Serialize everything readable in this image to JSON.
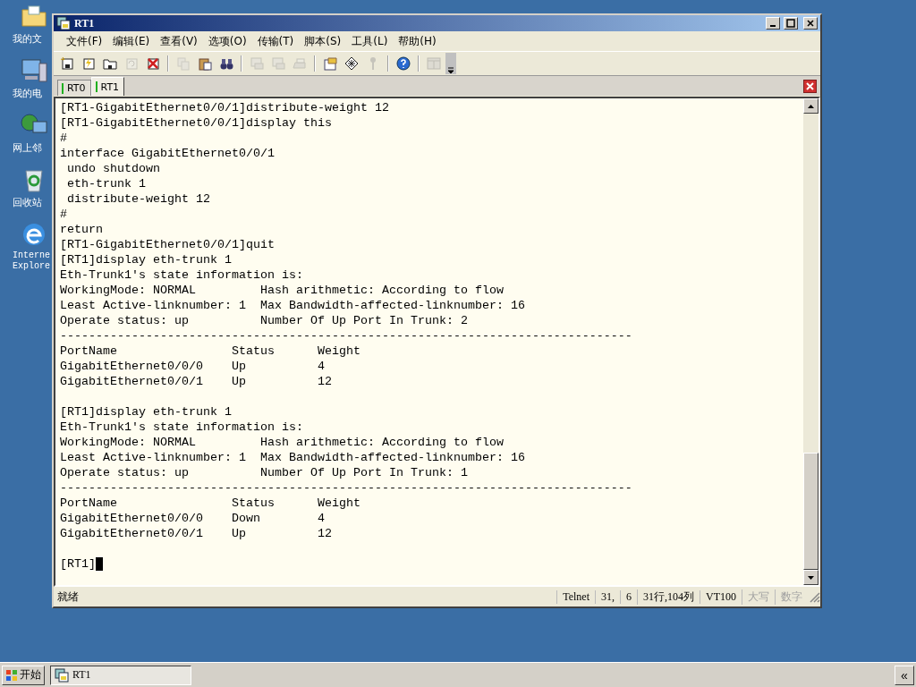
{
  "desktop_icons": [
    {
      "kind": "documents",
      "label": "我的文"
    },
    {
      "kind": "computer",
      "label": "我的电"
    },
    {
      "kind": "network",
      "label": "网上邻"
    },
    {
      "kind": "recycle",
      "label": "回收站"
    },
    {
      "kind": "browser",
      "label": "Interne\nExplore"
    }
  ],
  "window": {
    "title": "RT1"
  },
  "menu": [
    "文件(F)",
    "编辑(E)",
    "查看(V)",
    "选项(O)",
    "传输(T)",
    "脚本(S)",
    "工具(L)",
    "帮助(H)"
  ],
  "toolbar": [
    {
      "kind": "new-session",
      "disabled": false
    },
    {
      "kind": "quick-connect",
      "disabled": false
    },
    {
      "kind": "open-folder",
      "disabled": false
    },
    {
      "kind": "reconnect",
      "disabled": true
    },
    {
      "kind": "disconnect",
      "disabled": false
    },
    {
      "kind": "separator"
    },
    {
      "kind": "copy",
      "disabled": true
    },
    {
      "kind": "paste",
      "disabled": false
    },
    {
      "kind": "find",
      "disabled": false
    },
    {
      "kind": "separator"
    },
    {
      "kind": "print",
      "disabled": true
    },
    {
      "kind": "print",
      "disabled": true
    },
    {
      "kind": "printer",
      "disabled": true
    },
    {
      "kind": "separator"
    },
    {
      "kind": "options",
      "disabled": false
    },
    {
      "kind": "keymap",
      "disabled": false
    },
    {
      "kind": "key",
      "disabled": true
    },
    {
      "kind": "separator"
    },
    {
      "kind": "help",
      "disabled": false
    },
    {
      "kind": "separator"
    },
    {
      "kind": "tile",
      "disabled": true
    },
    {
      "kind": "more"
    }
  ],
  "tabs": [
    {
      "label": "RT0",
      "selected": false
    },
    {
      "label": "RT1",
      "selected": true
    }
  ],
  "terminal": {
    "lines": [
      {
        "kind": "text",
        "text": "[RT1-GigabitEthernet0/0/1]distribute-weight 12"
      },
      {
        "kind": "text",
        "text": "[RT1-GigabitEthernet0/0/1]display this"
      },
      {
        "kind": "text",
        "text": "#"
      },
      {
        "kind": "text",
        "text": "interface GigabitEthernet0/0/1"
      },
      {
        "kind": "text",
        "text": " undo shutdown"
      },
      {
        "kind": "text",
        "text": " eth-trunk 1"
      },
      {
        "kind": "text",
        "text": " distribute-weight 12"
      },
      {
        "kind": "text",
        "text": "#"
      },
      {
        "kind": "text",
        "text": "return"
      },
      {
        "kind": "text",
        "text": "[RT1-GigabitEthernet0/0/1]quit"
      },
      {
        "kind": "text",
        "text": "[RT1]display eth-trunk 1"
      },
      {
        "kind": "text",
        "text": "Eth-Trunk1's state information is:"
      },
      {
        "kind": "text",
        "text": "WorkingMode: NORMAL         Hash arithmetic: According to flow"
      },
      {
        "kind": "text",
        "text": "Least Active-linknumber: 1  Max Bandwidth-affected-linknumber: 16"
      },
      {
        "kind": "text",
        "text": "Operate status: up          Number Of Up Port In Trunk: 2"
      },
      {
        "kind": "text",
        "text": "--------------------------------------------------------------------------------"
      },
      {
        "kind": "text",
        "text": "PortName                Status      Weight"
      },
      {
        "kind": "text",
        "text": "GigabitEthernet0/0/0    Up          4"
      },
      {
        "kind": "text",
        "text": "GigabitEthernet0/0/1    Up          12"
      },
      {
        "kind": "blank"
      },
      {
        "kind": "text",
        "text": "[RT1]display eth-trunk 1"
      },
      {
        "kind": "text",
        "text": "Eth-Trunk1's state information is:"
      },
      {
        "kind": "text",
        "text": "WorkingMode: NORMAL         Hash arithmetic: According to flow"
      },
      {
        "kind": "text",
        "text": "Least Active-linknumber: 1  Max Bandwidth-affected-linknumber: 16"
      },
      {
        "kind": "text",
        "text": "Operate status: up          Number Of Up Port In Trunk: 1"
      },
      {
        "kind": "text",
        "text": "--------------------------------------------------------------------------------"
      },
      {
        "kind": "text",
        "text": "PortName                Status      Weight"
      },
      {
        "kind": "text",
        "text": "GigabitEthernet0/0/0    Down        4"
      },
      {
        "kind": "text",
        "text": "GigabitEthernet0/0/1    Up          12"
      },
      {
        "kind": "blank"
      },
      {
        "kind": "prompt",
        "text": "[RT1]"
      }
    ]
  },
  "status_bar": {
    "message": "就绪",
    "fields": [
      {
        "text": "Telnet",
        "disabled": false
      },
      {
        "text": "31,",
        "disabled": false
      },
      {
        "text": "6",
        "disabled": false
      },
      {
        "text": "31行,104列",
        "disabled": false
      },
      {
        "text": "VT100",
        "disabled": false
      },
      {
        "text": "大写",
        "disabled": true
      },
      {
        "text": "数字",
        "disabled": true
      }
    ]
  },
  "taskbar": {
    "start": "开始",
    "tasks": [
      {
        "label": "RT1",
        "selected": true
      }
    ],
    "tray_button": "«"
  }
}
